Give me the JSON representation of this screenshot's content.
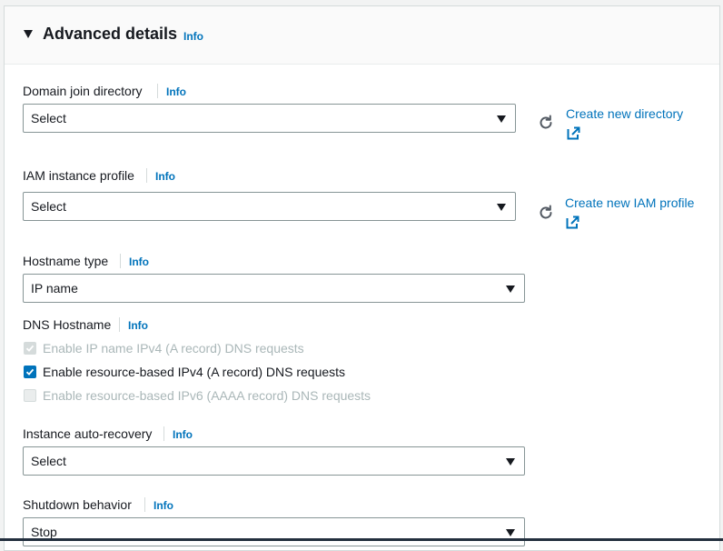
{
  "section": {
    "title": "Advanced details",
    "info": "Info"
  },
  "domain_join": {
    "label": "Domain join directory",
    "info": "Info",
    "value": "Select",
    "create_link": "Create new directory"
  },
  "iam_profile": {
    "label": "IAM instance profile",
    "info": "Info",
    "value": "Select",
    "create_link": "Create new IAM profile"
  },
  "hostname_type": {
    "label": "Hostname type",
    "info": "Info",
    "value": "IP name"
  },
  "dns_hostname": {
    "label": "DNS Hostname",
    "info": "Info",
    "options": [
      {
        "label": "Enable IP name IPv4 (A record) DNS requests",
        "checked": true,
        "disabled": true
      },
      {
        "label": "Enable resource-based IPv4 (A record) DNS requests",
        "checked": true,
        "disabled": false
      },
      {
        "label": "Enable resource-based IPv6 (AAAA record) DNS requests",
        "checked": false,
        "disabled": true
      }
    ]
  },
  "auto_recovery": {
    "label": "Instance auto-recovery",
    "info": "Info",
    "value": "Select"
  },
  "shutdown": {
    "label": "Shutdown behavior",
    "info": "Info",
    "value": "Stop"
  },
  "colors": {
    "accent": "#0073bb",
    "text": "#16191f",
    "disabled_text": "#aab7b8",
    "border": "#879596"
  }
}
